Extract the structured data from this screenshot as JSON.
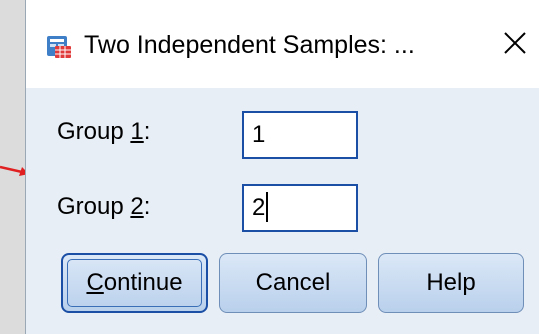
{
  "dialog": {
    "title": "Two Independent Samples: ...",
    "close_glyph": "✕"
  },
  "group1": {
    "label_prefix": "Group ",
    "label_mnemonic": "1",
    "label_suffix": ":",
    "value": "1"
  },
  "group2": {
    "label_prefix": "Group ",
    "label_mnemonic": "2",
    "label_suffix": ":",
    "value": "2"
  },
  "buttons": {
    "continue_mnemonic": "C",
    "continue_rest": "ontinue",
    "cancel": "Cancel",
    "help": "Help"
  },
  "icons": {
    "app": "spss-table-icon",
    "close": "close-icon",
    "annotation": "red-arrow-icon"
  },
  "colors": {
    "accent": "#1b4fa5",
    "annotation": "#e02020",
    "button_fill": "#c8dbf1"
  }
}
